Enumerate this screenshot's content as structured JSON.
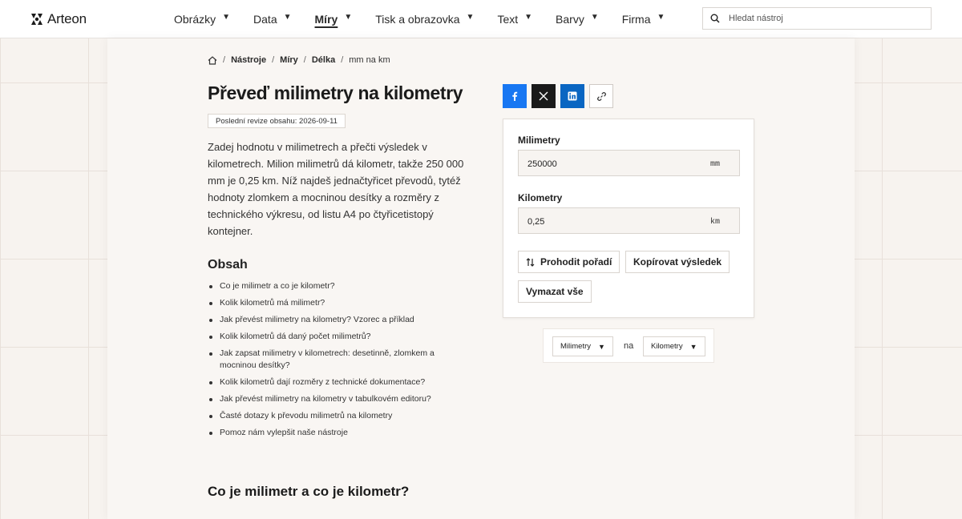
{
  "header": {
    "brand": "Arteon",
    "nav": [
      {
        "label": "Obrázky"
      },
      {
        "label": "Data"
      },
      {
        "label": "Míry"
      },
      {
        "label": "Tisk a obrazovka"
      },
      {
        "label": "Text"
      },
      {
        "label": "Barvy"
      },
      {
        "label": "Firma"
      }
    ],
    "active_nav": "Míry",
    "search_placeholder": "Hledat nástroj"
  },
  "breadcrumb": [
    "Nástroje",
    "Míry",
    "Délka",
    "mm na km"
  ],
  "page": {
    "title": "Převeď milimetry na kilometry",
    "revision": "Poslední revize obsahu: 2026-09-11",
    "intro": "Zadej hodnotu v milimetrech a přečti výsledek v kilometrech. Milion milimetrů dá kilometr, takže 250 000 mm je 0,25 km. Níž najdeš jednačtyřicet převodů, tytéž hodnoty zlomkem a mocninou desítky a rozměry z technického výkresu, od listu A4 po čtyřicetistopý kontejner.",
    "toc_title": "Obsah",
    "toc": [
      "Co je milimetr a co je kilometr?",
      "Kolik kilometrů má milimetr?",
      "Jak převést milimetry na kilometry? Vzorec a příklad",
      "Kolik kilometrů dá daný počet milimetrů?",
      "Jak zapsat milimetry v kilometrech: desetinně, zlomkem a mocninou desítky?",
      "Kolik kilometrů dají rozměry z technické dokumentace?",
      "Jak převést milimetry na kilometry v tabulkovém editoru?",
      "Časté dotazy k převodu milimetrů na kilometry",
      "Pomoz nám vylepšit naše nástroje"
    ],
    "section_heading": "Co je milimetr a co je kilometr?"
  },
  "share": [
    "facebook-icon",
    "x-icon",
    "linkedin-icon",
    "link-icon"
  ],
  "converter": {
    "from_label": "Milimetry",
    "from_value": "250000",
    "from_unit": "mm",
    "to_label": "Kilometry",
    "to_value": "0,25",
    "to_unit": "km",
    "swap_label": "Prohodit pořadí",
    "copy_label": "Kopírovat výsledek",
    "clear_label": "Vymazat vše"
  },
  "unit_select": {
    "from": "Milimetry",
    "joiner": "na",
    "to": "Kilometry"
  },
  "colors": {
    "facebook": "#1877f2",
    "x": "#1a1a1a",
    "linkedin": "#0a66c2"
  }
}
